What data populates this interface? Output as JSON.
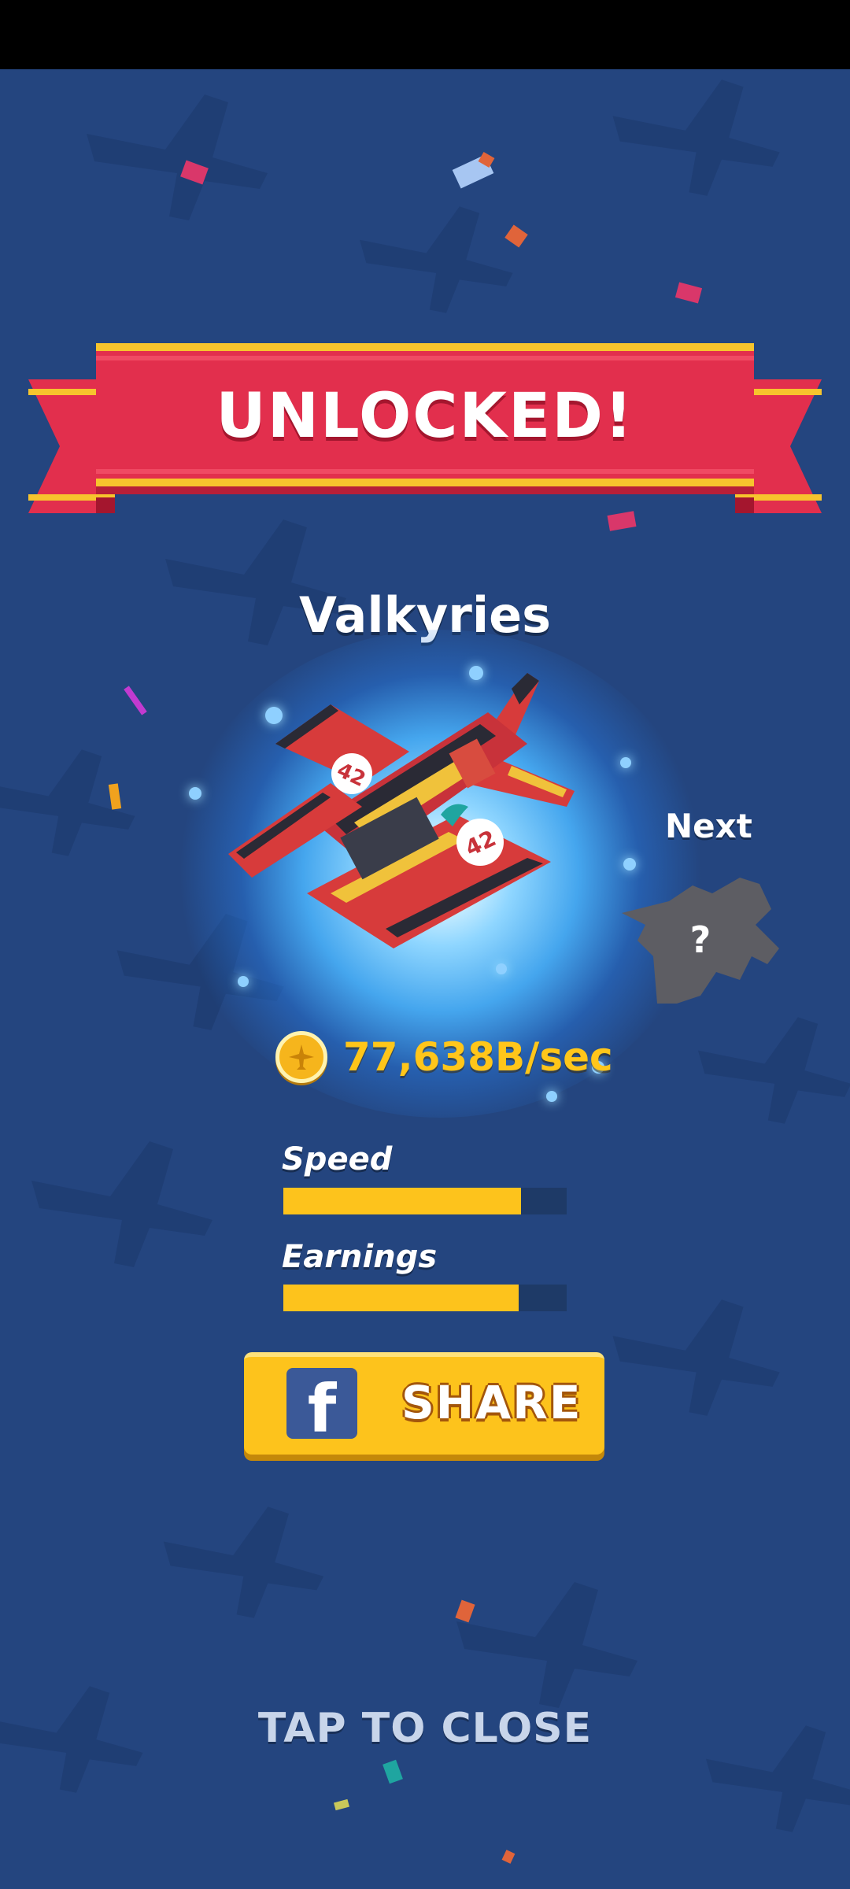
{
  "banner": {
    "title": "UNLOCKED!"
  },
  "plane": {
    "name": "Valkyries",
    "number": "42"
  },
  "next": {
    "label": "Next",
    "mystery": "?"
  },
  "earnings": {
    "rate": "77,638B/sec"
  },
  "stats": [
    {
      "label": "Speed",
      "level": 0.84
    },
    {
      "label": "Earnings",
      "level": 0.83
    }
  ],
  "share": {
    "label": "SHARE",
    "icon": "facebook-icon"
  },
  "close": {
    "label": "TAP TO CLOSE"
  },
  "colors": {
    "background": "#24457f",
    "ribbon": "#e22f4d",
    "gold": "#fdc31c",
    "facebook": "#3b5998"
  }
}
